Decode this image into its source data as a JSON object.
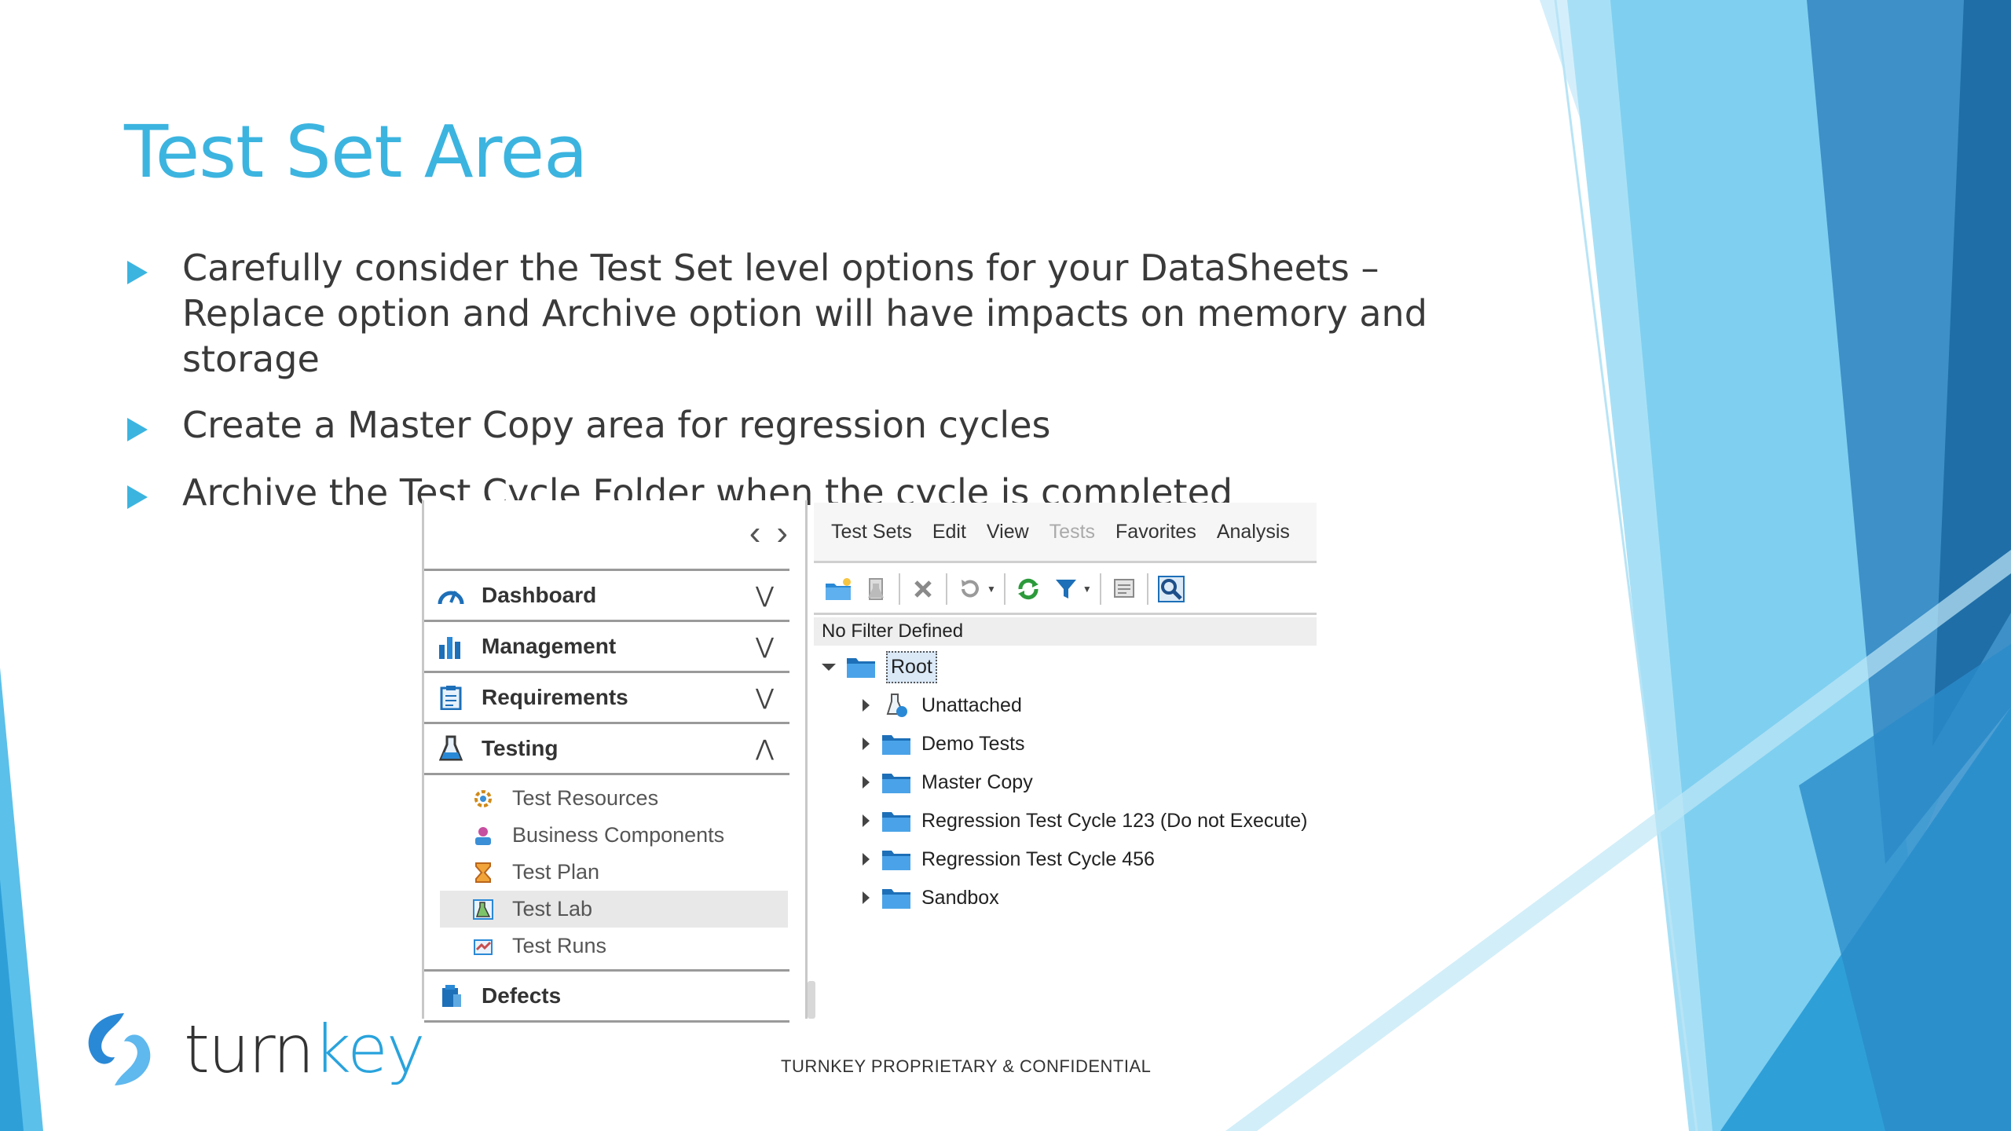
{
  "slide": {
    "title": "Test Set Area",
    "bullets": [
      "Carefully consider the Test Set level options for your DataSheets – Replace option and Archive option will have impacts on memory and storage",
      "Create a Master Copy area for regression cycles",
      "Archive the Test Cycle Folder when the cycle is completed"
    ],
    "footer": "TURNKEY PROPRIETARY & CONFIDENTIAL",
    "logo": {
      "text_main": "turn",
      "text_accent": "key",
      "icon": "turnkey-swirl-logo"
    }
  },
  "colors": {
    "accent": "#3cb4e0",
    "body_text": "#3a3a3a",
    "deco_dark": "#1f6ea8",
    "deco_light": "#8fd3f2"
  },
  "navigator": {
    "back_icon": "chevron-left-icon",
    "forward_icon": "chevron-right-icon",
    "modules": [
      {
        "label": "Dashboard",
        "icon": "gauge-icon",
        "state": "collapsed"
      },
      {
        "label": "Management",
        "icon": "bar-chart-icon",
        "state": "collapsed"
      },
      {
        "label": "Requirements",
        "icon": "clipboard-icon",
        "state": "collapsed"
      },
      {
        "label": "Testing",
        "icon": "flask-icon",
        "state": "expanded"
      },
      {
        "label": "Defects",
        "icon": "bug-icon",
        "state": "collapsed"
      }
    ],
    "testing_items": [
      {
        "label": "Test Resources",
        "icon": "resources-icon",
        "selected": false
      },
      {
        "label": "Business Components",
        "icon": "components-icon",
        "selected": false
      },
      {
        "label": "Test Plan",
        "icon": "test-plan-icon",
        "selected": false
      },
      {
        "label": "Test Lab",
        "icon": "test-lab-icon",
        "selected": true
      },
      {
        "label": "Test Runs",
        "icon": "test-runs-icon",
        "selected": false
      }
    ]
  },
  "test_lab": {
    "menu": [
      {
        "label": "Test Sets",
        "enabled": true
      },
      {
        "label": "Edit",
        "enabled": true
      },
      {
        "label": "View",
        "enabled": true
      },
      {
        "label": "Tests",
        "enabled": false
      },
      {
        "label": "Favorites",
        "enabled": true
      },
      {
        "label": "Analysis",
        "enabled": true
      }
    ],
    "toolbar": [
      "new-folder-icon",
      "new-test-set-icon",
      "delete-icon",
      "reset-icon",
      "refresh-icon",
      "filter-icon",
      "details-icon",
      "find-icon"
    ],
    "filter_text": "No Filter Defined",
    "tree": {
      "root": "Root",
      "children": [
        {
          "label": "Unattached",
          "icon": "unattached-icon"
        },
        {
          "label": "Demo Tests",
          "icon": "folder-icon"
        },
        {
          "label": "Master Copy",
          "icon": "folder-icon"
        },
        {
          "label": "Regression Test Cycle 123 (Do not Execute)",
          "icon": "folder-icon"
        },
        {
          "label": "Regression Test Cycle 456",
          "icon": "folder-icon"
        },
        {
          "label": "Sandbox",
          "icon": "folder-icon"
        }
      ]
    }
  }
}
